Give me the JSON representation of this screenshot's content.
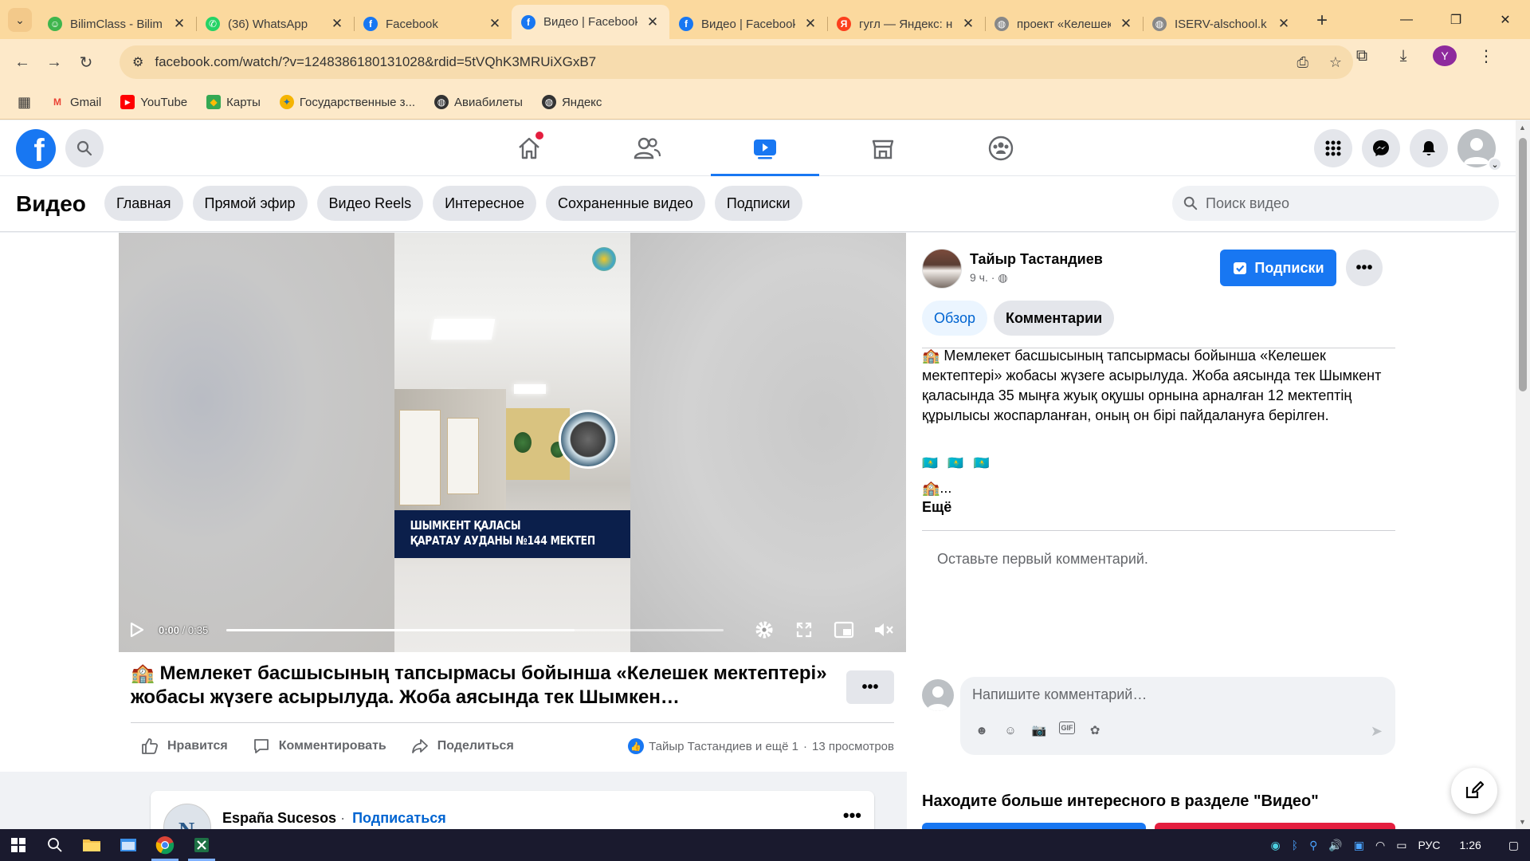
{
  "browser": {
    "tabs": [
      {
        "title": "BilimClass - Bilim",
        "icon": "bilimclass-icon",
        "active": false
      },
      {
        "title": "(36) WhatsApp",
        "icon": "whatsapp-icon",
        "active": false
      },
      {
        "title": "Facebook",
        "icon": "facebook-icon",
        "active": false
      },
      {
        "title": "Видео | Facebook",
        "icon": "facebook-icon",
        "active": true
      },
      {
        "title": "Видео | Facebook",
        "icon": "facebook-icon",
        "active": false
      },
      {
        "title": "гугл — Яндекс: н",
        "icon": "yandex-icon",
        "active": false
      },
      {
        "title": "проект «Келешек",
        "icon": "globe-icon",
        "active": false
      },
      {
        "title": "ISERV-alschool.k",
        "icon": "globe-icon",
        "active": false
      }
    ],
    "url": "facebook.com/watch/?v=1248386180131028&rdid=5tVQhK3MRUiXGxB7",
    "profile_letter": "Y",
    "bookmarks": [
      {
        "label": "Gmail",
        "icon": "gmail-icon"
      },
      {
        "label": "YouTube",
        "icon": "youtube-icon"
      },
      {
        "label": "Карты",
        "icon": "maps-icon"
      },
      {
        "label": "Государственные з...",
        "icon": "gov-icon"
      },
      {
        "label": "Авиабилеты",
        "icon": "globe-icon"
      },
      {
        "label": "Яндекс",
        "icon": "globe-icon"
      }
    ]
  },
  "fb": {
    "page_title": "Видео",
    "pills": [
      "Главная",
      "Прямой эфир",
      "Видео Reels",
      "Интересное",
      "Сохраненные видео",
      "Подписки"
    ],
    "search_placeholder": "Поиск видео"
  },
  "video": {
    "caption_line1": "ШЫМКЕНТ ҚАЛАСЫ",
    "caption_line2": "ҚАРАТАУ АУДАНЫ №144 МЕКТЕП",
    "time_current": "0:00",
    "time_total": "0:35",
    "buffered_fraction": 0.7,
    "title": "🏫 Мемлекет басшысының тапсырмасы бойынша «Келешек мектептері» жобасы жүзеге асырылуда. Жоба аясында тек Шымкен…",
    "actions": {
      "like": "Нравится",
      "comment": "Комментировать",
      "share": "Поделиться"
    },
    "reactions_text": "Тайыр Тастандиев и ещё 1",
    "views": "13 просмотров"
  },
  "side": {
    "author": "Тайыр Тастандиев",
    "time": "9 ч.",
    "subscribe_label": "Подписки",
    "tabs": [
      "Обзор",
      "Комментарии"
    ],
    "description": "🏫 Мемлекет басшысының тапсырмасы бойынша «Келешек мектептері» жобасы жүзеге асырылуда. Жоба аясында тек Шымкент қаласында 35 мыңға жуық оқушы орнына арналған 12 мектептің құрылысы жоспарланған, оның он бірі пайдалануға берілген.",
    "flags": "🇰🇿 🇰🇿 🇰🇿",
    "house_line": "🏫...",
    "more_label": "Ещё",
    "first_comment": "Оставьте первый комментарий.",
    "comment_placeholder": "Напишите комментарий…",
    "explore": "Находите больше интересного в разделе \"Видео\""
  },
  "feed": {
    "author": "España Sucesos",
    "separator": "·",
    "follow": "Подписаться"
  },
  "taskbar": {
    "lang": "РУС",
    "time": "1:26"
  },
  "colors": {
    "fb_blue": "#1877f2",
    "chrome_tab_bg": "#fbd99e",
    "chrome_toolbar": "#fde9c9"
  }
}
